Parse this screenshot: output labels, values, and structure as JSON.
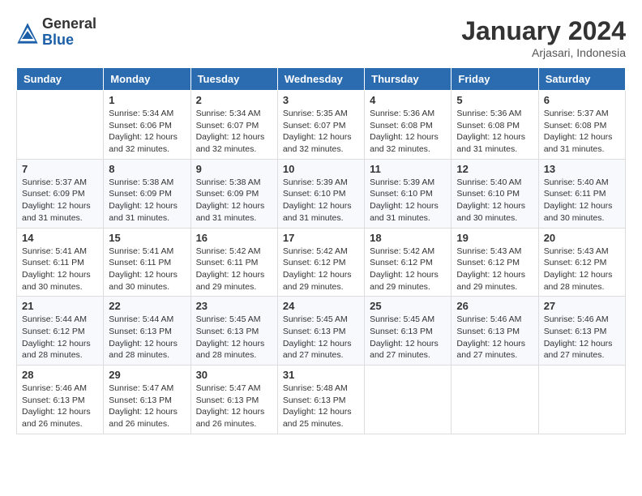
{
  "header": {
    "logo_general": "General",
    "logo_blue": "Blue",
    "month_title": "January 2024",
    "location": "Arjasari, Indonesia"
  },
  "days_of_week": [
    "Sunday",
    "Monday",
    "Tuesday",
    "Wednesday",
    "Thursday",
    "Friday",
    "Saturday"
  ],
  "weeks": [
    [
      {
        "day": "",
        "detail": ""
      },
      {
        "day": "1",
        "detail": "Sunrise: 5:34 AM\nSunset: 6:06 PM\nDaylight: 12 hours\nand 32 minutes."
      },
      {
        "day": "2",
        "detail": "Sunrise: 5:34 AM\nSunset: 6:07 PM\nDaylight: 12 hours\nand 32 minutes."
      },
      {
        "day": "3",
        "detail": "Sunrise: 5:35 AM\nSunset: 6:07 PM\nDaylight: 12 hours\nand 32 minutes."
      },
      {
        "day": "4",
        "detail": "Sunrise: 5:36 AM\nSunset: 6:08 PM\nDaylight: 12 hours\nand 32 minutes."
      },
      {
        "day": "5",
        "detail": "Sunrise: 5:36 AM\nSunset: 6:08 PM\nDaylight: 12 hours\nand 31 minutes."
      },
      {
        "day": "6",
        "detail": "Sunrise: 5:37 AM\nSunset: 6:08 PM\nDaylight: 12 hours\nand 31 minutes."
      }
    ],
    [
      {
        "day": "7",
        "detail": "Sunrise: 5:37 AM\nSunset: 6:09 PM\nDaylight: 12 hours\nand 31 minutes."
      },
      {
        "day": "8",
        "detail": "Sunrise: 5:38 AM\nSunset: 6:09 PM\nDaylight: 12 hours\nand 31 minutes."
      },
      {
        "day": "9",
        "detail": "Sunrise: 5:38 AM\nSunset: 6:09 PM\nDaylight: 12 hours\nand 31 minutes."
      },
      {
        "day": "10",
        "detail": "Sunrise: 5:39 AM\nSunset: 6:10 PM\nDaylight: 12 hours\nand 31 minutes."
      },
      {
        "day": "11",
        "detail": "Sunrise: 5:39 AM\nSunset: 6:10 PM\nDaylight: 12 hours\nand 31 minutes."
      },
      {
        "day": "12",
        "detail": "Sunrise: 5:40 AM\nSunset: 6:10 PM\nDaylight: 12 hours\nand 30 minutes."
      },
      {
        "day": "13",
        "detail": "Sunrise: 5:40 AM\nSunset: 6:11 PM\nDaylight: 12 hours\nand 30 minutes."
      }
    ],
    [
      {
        "day": "14",
        "detail": "Sunrise: 5:41 AM\nSunset: 6:11 PM\nDaylight: 12 hours\nand 30 minutes."
      },
      {
        "day": "15",
        "detail": "Sunrise: 5:41 AM\nSunset: 6:11 PM\nDaylight: 12 hours\nand 30 minutes."
      },
      {
        "day": "16",
        "detail": "Sunrise: 5:42 AM\nSunset: 6:11 PM\nDaylight: 12 hours\nand 29 minutes."
      },
      {
        "day": "17",
        "detail": "Sunrise: 5:42 AM\nSunset: 6:12 PM\nDaylight: 12 hours\nand 29 minutes."
      },
      {
        "day": "18",
        "detail": "Sunrise: 5:42 AM\nSunset: 6:12 PM\nDaylight: 12 hours\nand 29 minutes."
      },
      {
        "day": "19",
        "detail": "Sunrise: 5:43 AM\nSunset: 6:12 PM\nDaylight: 12 hours\nand 29 minutes."
      },
      {
        "day": "20",
        "detail": "Sunrise: 5:43 AM\nSunset: 6:12 PM\nDaylight: 12 hours\nand 28 minutes."
      }
    ],
    [
      {
        "day": "21",
        "detail": "Sunrise: 5:44 AM\nSunset: 6:12 PM\nDaylight: 12 hours\nand 28 minutes."
      },
      {
        "day": "22",
        "detail": "Sunrise: 5:44 AM\nSunset: 6:13 PM\nDaylight: 12 hours\nand 28 minutes."
      },
      {
        "day": "23",
        "detail": "Sunrise: 5:45 AM\nSunset: 6:13 PM\nDaylight: 12 hours\nand 28 minutes."
      },
      {
        "day": "24",
        "detail": "Sunrise: 5:45 AM\nSunset: 6:13 PM\nDaylight: 12 hours\nand 27 minutes."
      },
      {
        "day": "25",
        "detail": "Sunrise: 5:45 AM\nSunset: 6:13 PM\nDaylight: 12 hours\nand 27 minutes."
      },
      {
        "day": "26",
        "detail": "Sunrise: 5:46 AM\nSunset: 6:13 PM\nDaylight: 12 hours\nand 27 minutes."
      },
      {
        "day": "27",
        "detail": "Sunrise: 5:46 AM\nSunset: 6:13 PM\nDaylight: 12 hours\nand 27 minutes."
      }
    ],
    [
      {
        "day": "28",
        "detail": "Sunrise: 5:46 AM\nSunset: 6:13 PM\nDaylight: 12 hours\nand 26 minutes."
      },
      {
        "day": "29",
        "detail": "Sunrise: 5:47 AM\nSunset: 6:13 PM\nDaylight: 12 hours\nand 26 minutes."
      },
      {
        "day": "30",
        "detail": "Sunrise: 5:47 AM\nSunset: 6:13 PM\nDaylight: 12 hours\nand 26 minutes."
      },
      {
        "day": "31",
        "detail": "Sunrise: 5:48 AM\nSunset: 6:13 PM\nDaylight: 12 hours\nand 25 minutes."
      },
      {
        "day": "",
        "detail": ""
      },
      {
        "day": "",
        "detail": ""
      },
      {
        "day": "",
        "detail": ""
      }
    ]
  ]
}
